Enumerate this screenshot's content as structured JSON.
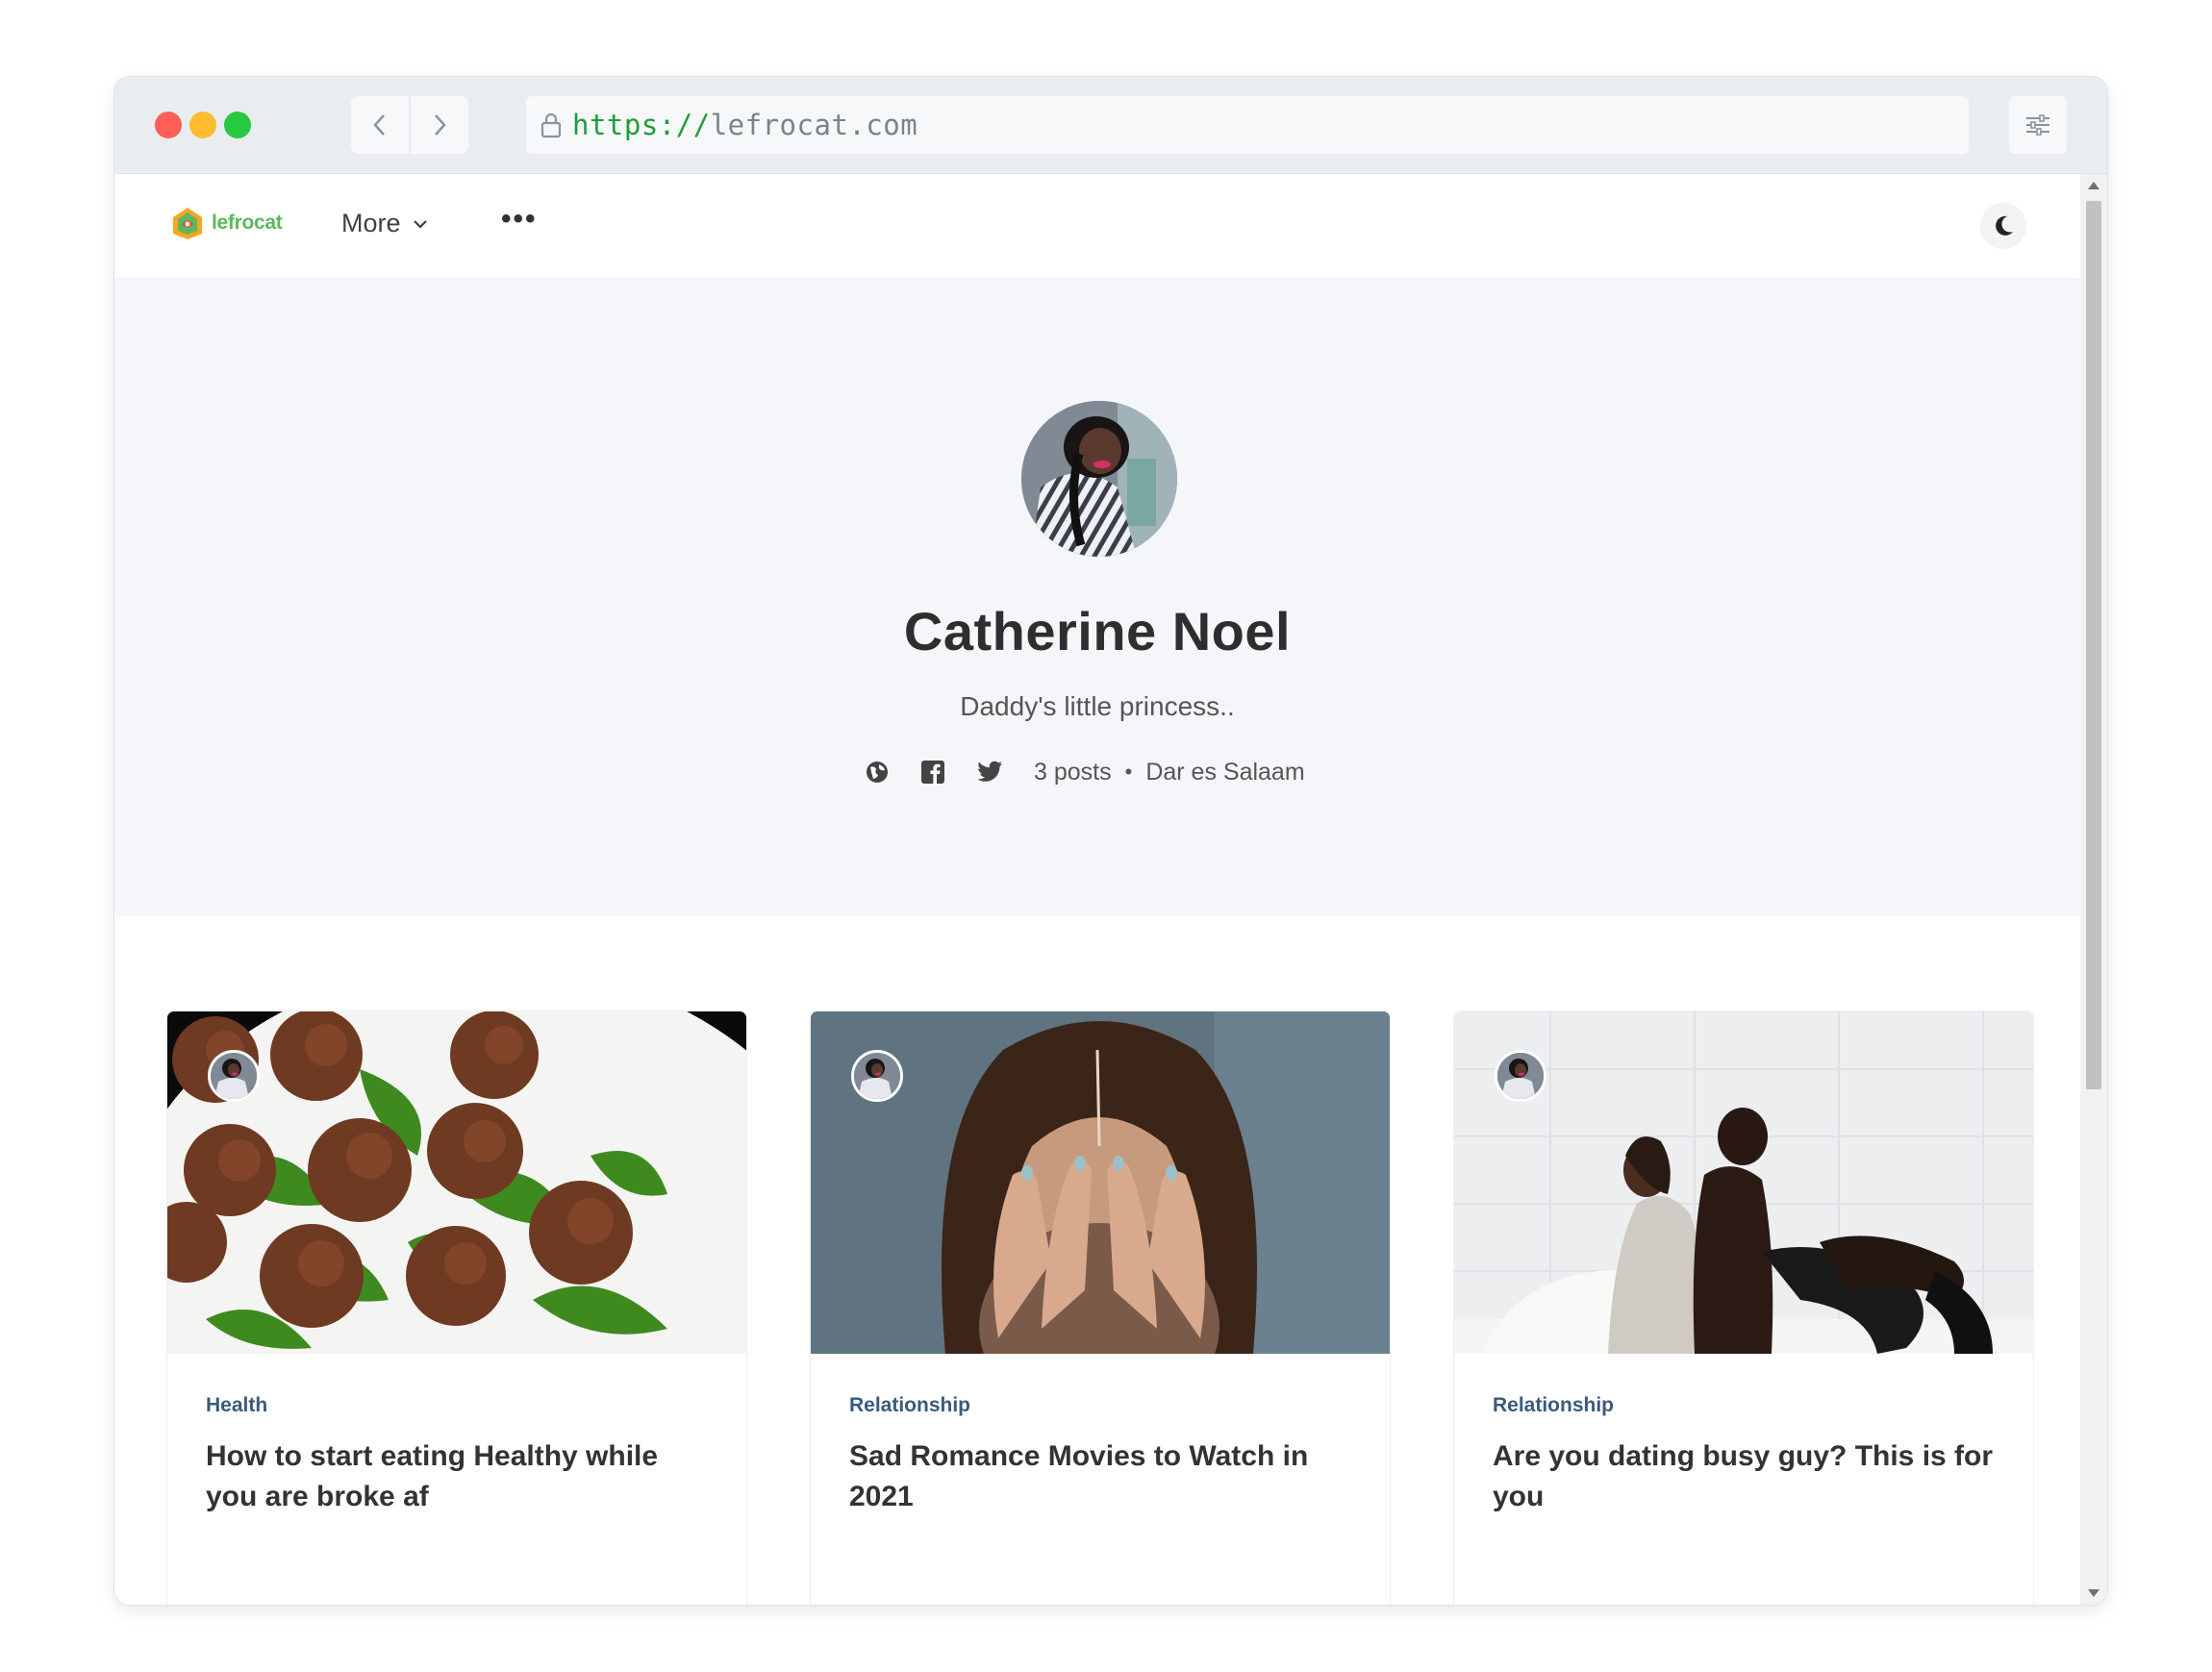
{
  "browser": {
    "url_scheme": "https://",
    "url_host": "lefrocat.com"
  },
  "site": {
    "logo_text": "lefrocat",
    "nav_more_label": "More",
    "nav_dots": "•••"
  },
  "profile": {
    "name": "Catherine Noel",
    "bio": "Daddy's little princess..",
    "posts": "3 posts",
    "separator": "•",
    "location": "Dar es Salaam"
  },
  "posts": [
    {
      "tag": "Health",
      "title": "How to start eating Healthy while you are broke af"
    },
    {
      "tag": "Relationship",
      "title": "Sad Romance Movies to Watch in 2021"
    },
    {
      "tag": "Relationship",
      "title": "Are you dating busy guy? This is for you"
    }
  ],
  "colors": {
    "accent_green": "#1f9d3a",
    "logo_green": "#5cb85c",
    "tag_blue": "#3a5a7c",
    "profile_bg": "#f4f6fa"
  },
  "icons": [
    "lock-icon",
    "chevron-left-icon",
    "chevron-right-icon",
    "sliders-icon",
    "moon-icon",
    "globe-icon",
    "facebook-icon",
    "twitter-icon"
  ]
}
